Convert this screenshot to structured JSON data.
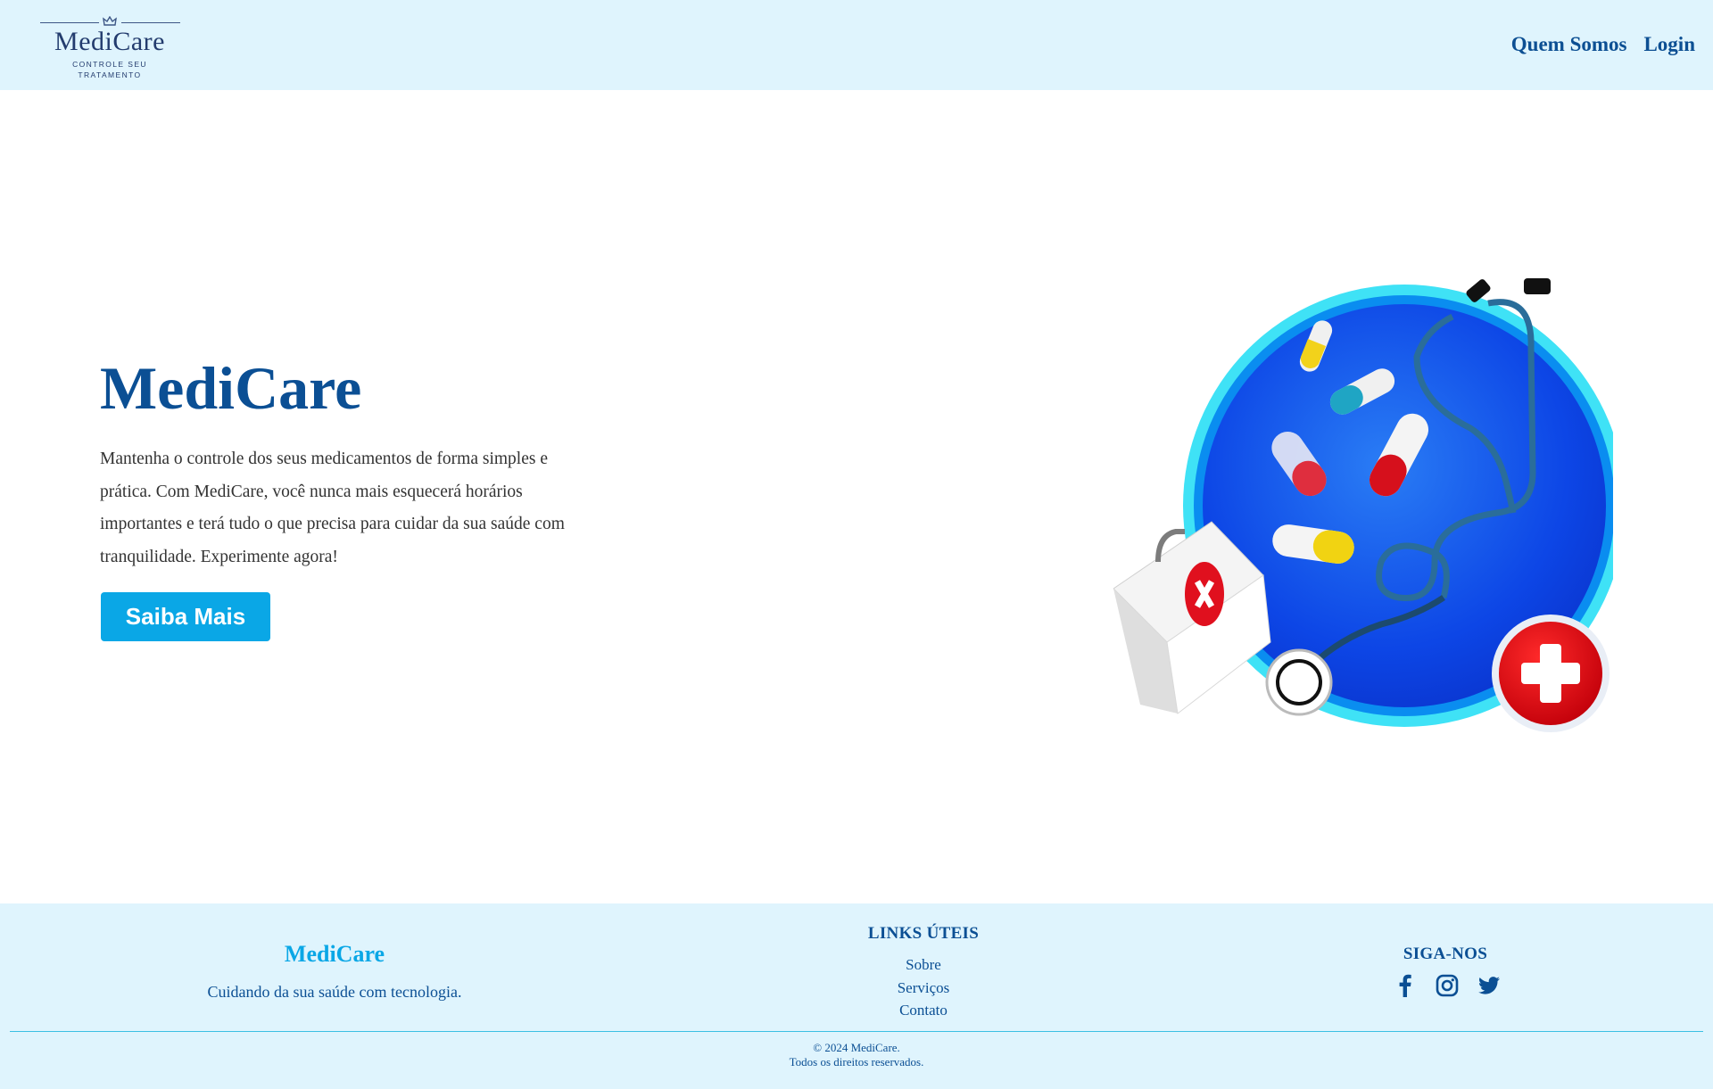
{
  "header": {
    "logo": {
      "name": "MediCare",
      "tagline": "CONTROLE SEU TRATAMENTO"
    },
    "nav": [
      {
        "label": "Quem Somos"
      },
      {
        "label": "Login"
      }
    ]
  },
  "hero": {
    "title": "MediCare",
    "description": "Mantenha o controle dos seus medicamentos de forma simples e prática. Com MediCare, você nunca mais esquecerá horários importantes e terá tudo o que precisa para cuidar da sua saúde com tranquilidade. Experimente agora!",
    "cta_label": "Saiba Mais"
  },
  "footer": {
    "brand": "MediCare",
    "slogan": "Cuidando da sua saúde com tecnologia.",
    "links_title": "LINKS ÚTEIS",
    "links": [
      "Sobre",
      "Serviços",
      "Contato"
    ],
    "social_title": "SIGA-NOS",
    "social": [
      "facebook-icon",
      "instagram-icon",
      "twitter-icon"
    ],
    "copyright_line1": "© 2024 MediCare.",
    "copyright_line2": "Todos os direitos reservados."
  },
  "colors": {
    "header_bg": "#dff4fd",
    "primary": "#0b4f94",
    "accent": "#0aa7e6",
    "text": "#333333"
  }
}
